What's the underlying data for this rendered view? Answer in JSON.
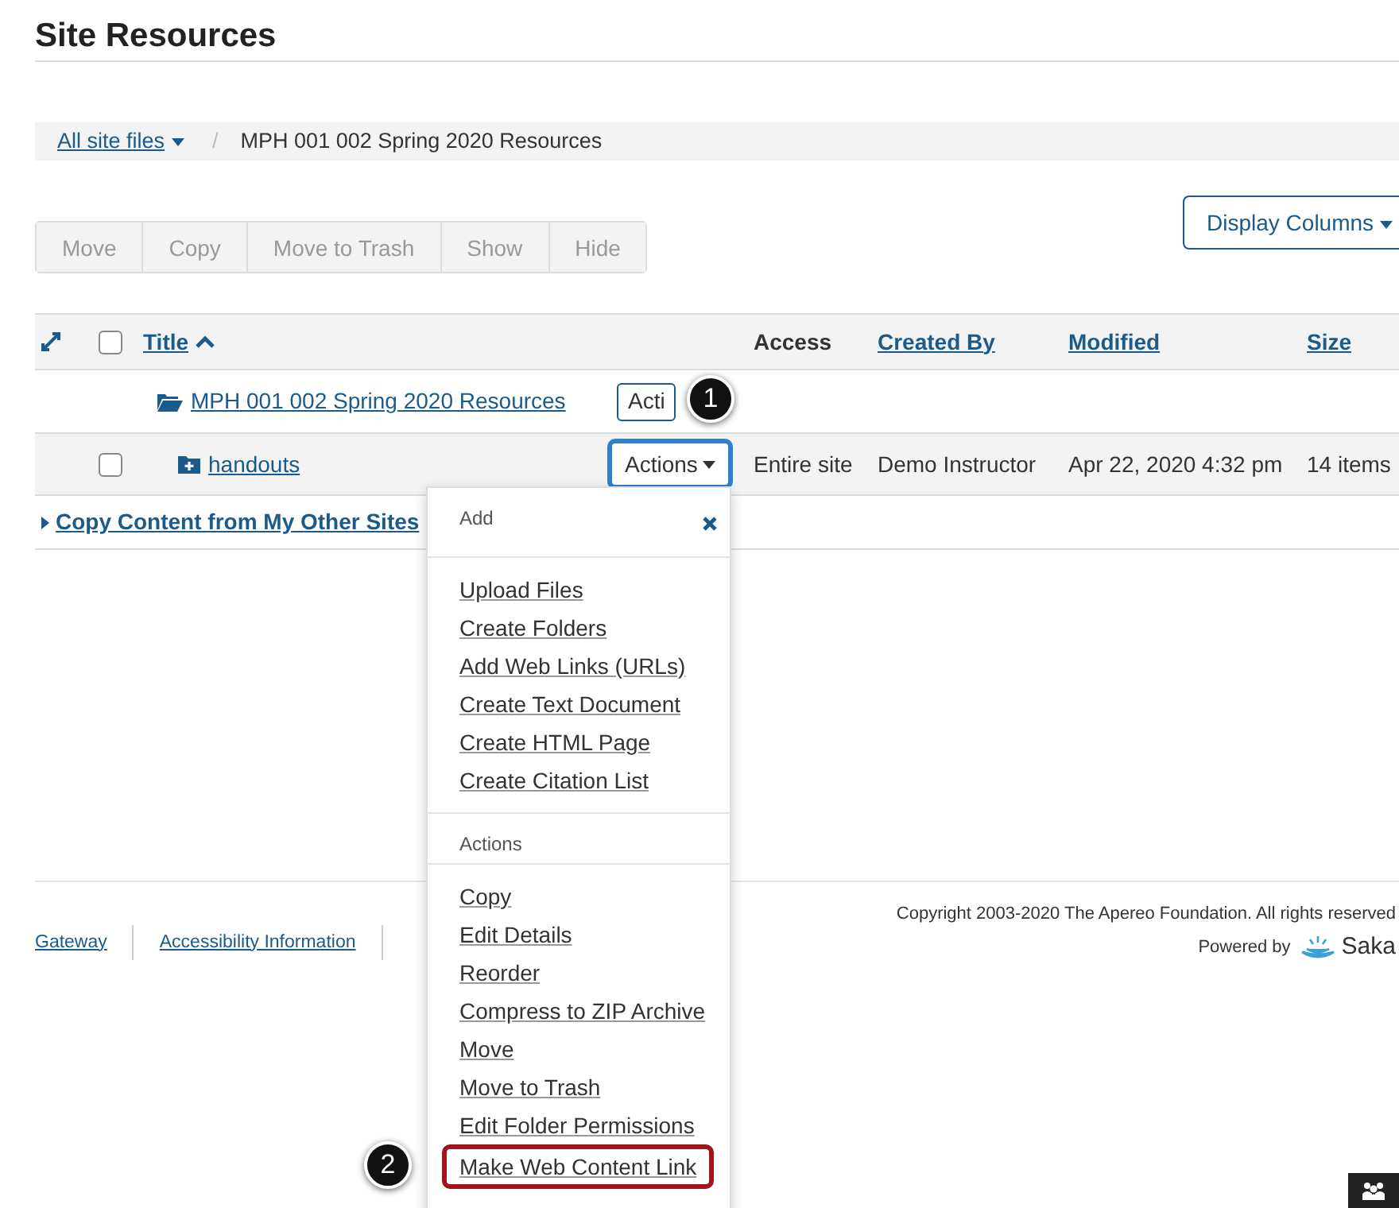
{
  "page_title": "Site Resources",
  "breadcrumb": {
    "items": [
      {
        "label": "All site files",
        "kind": "dropdown"
      },
      {
        "label": "MPH 001 002 Spring 2020 Resources",
        "kind": "current"
      }
    ],
    "separator": "/"
  },
  "toolbar": [
    {
      "label": "Move",
      "disabled": true
    },
    {
      "label": "Copy",
      "disabled": true
    },
    {
      "label": "Move to Trash",
      "disabled": true
    },
    {
      "label": "Show",
      "disabled": true
    },
    {
      "label": "Hide",
      "disabled": true
    }
  ],
  "display_columns": "Display Columns",
  "table": {
    "select_all_checked": false,
    "columns": [
      {
        "label": "Title",
        "kind": "link",
        "sorted_ascending": true
      },
      {
        "label": "Access",
        "kind": "plain"
      },
      {
        "label": "Created By",
        "kind": "link"
      },
      {
        "label": "Modified",
        "kind": "link"
      },
      {
        "label": "Size",
        "kind": "link"
      }
    ],
    "rows": [
      {
        "kind": "collection",
        "title": "MPH 001 002 Spring 2020 Resources",
        "actions": "Acti",
        "actions_highlighted": false,
        "expanded": false,
        "callout": "1"
      },
      {
        "kind": "folder",
        "title": "handouts",
        "checked": false,
        "actions": "Actions",
        "actions_highlighted": true,
        "expanded": true,
        "access": "Entire site",
        "created_by": "Demo Instructor",
        "modified": "Apr 22, 2020 4:32 pm",
        "size": "14 items"
      }
    ]
  },
  "copy_content": "Copy Content from My Other Sites",
  "menu": {
    "sections": [
      {
        "heading": "Add",
        "items": [
          {
            "label": "Upload Files",
            "highlighted": false
          },
          {
            "label": "Create Folders",
            "highlighted": false
          },
          {
            "label": "Add Web Links (URLs)",
            "highlighted": false
          },
          {
            "label": "Create Text Document",
            "highlighted": false
          },
          {
            "label": "Create HTML Page",
            "highlighted": false
          },
          {
            "label": "Create Citation List",
            "highlighted": false
          }
        ]
      },
      {
        "heading": "Actions",
        "items": [
          {
            "label": "Copy",
            "highlighted": false
          },
          {
            "label": "Edit Details",
            "highlighted": false
          },
          {
            "label": "Reorder",
            "highlighted": false
          },
          {
            "label": "Compress to ZIP Archive",
            "highlighted": false
          },
          {
            "label": "Move",
            "highlighted": false
          },
          {
            "label": "Move to Trash",
            "highlighted": false
          },
          {
            "label": "Edit Folder Permissions",
            "highlighted": false
          },
          {
            "label": "Make Web Content Link",
            "highlighted": true,
            "callout": "2"
          }
        ]
      }
    ]
  },
  "footer": {
    "links": [
      "Gateway",
      "Accessibility Information"
    ],
    "copyright": "Copyright 2003-2020 The Apereo Foundation. All rights reserved",
    "powered_by": "Powered by",
    "logo_text": "Saka"
  }
}
